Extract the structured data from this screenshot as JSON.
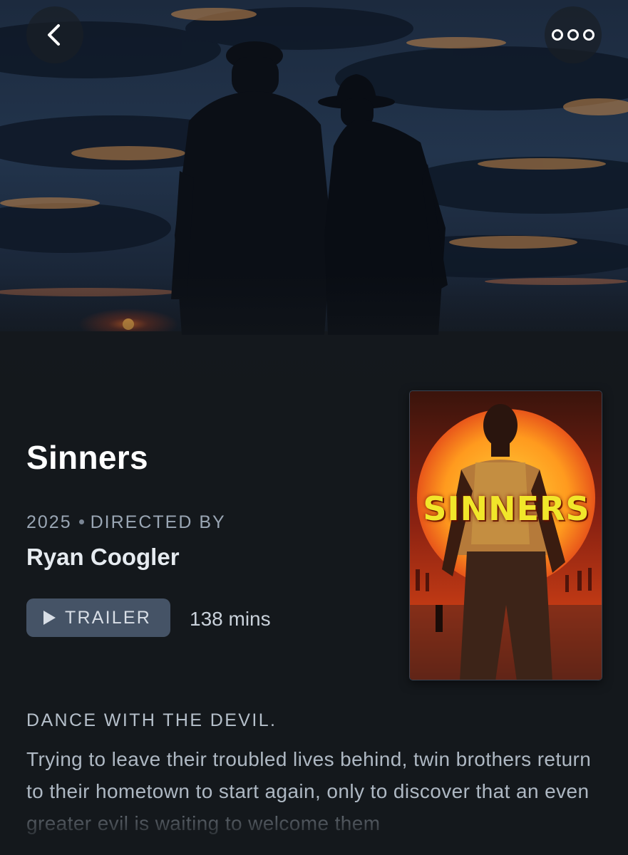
{
  "nav": {
    "back_icon": "chevron-left-icon",
    "more_icon": "more-options-icon"
  },
  "film": {
    "title": "Sinners",
    "year": "2025",
    "directed_by_label": "DIRECTED BY",
    "director": "Ryan Coogler",
    "trailer_label": "TRAILER",
    "runtime": "138 mins",
    "poster_title": "SINNERS",
    "tagline": "DANCE WITH THE DEVIL.",
    "synopsis": "Trying to leave their troubled lives behind, twin brothers return to their hometown to start again, only to discover that an even greater evil is waiting to welcome them"
  },
  "colors": {
    "background": "#14181c",
    "trailer_button": "#455366",
    "poster_title": "#f1e62a"
  }
}
